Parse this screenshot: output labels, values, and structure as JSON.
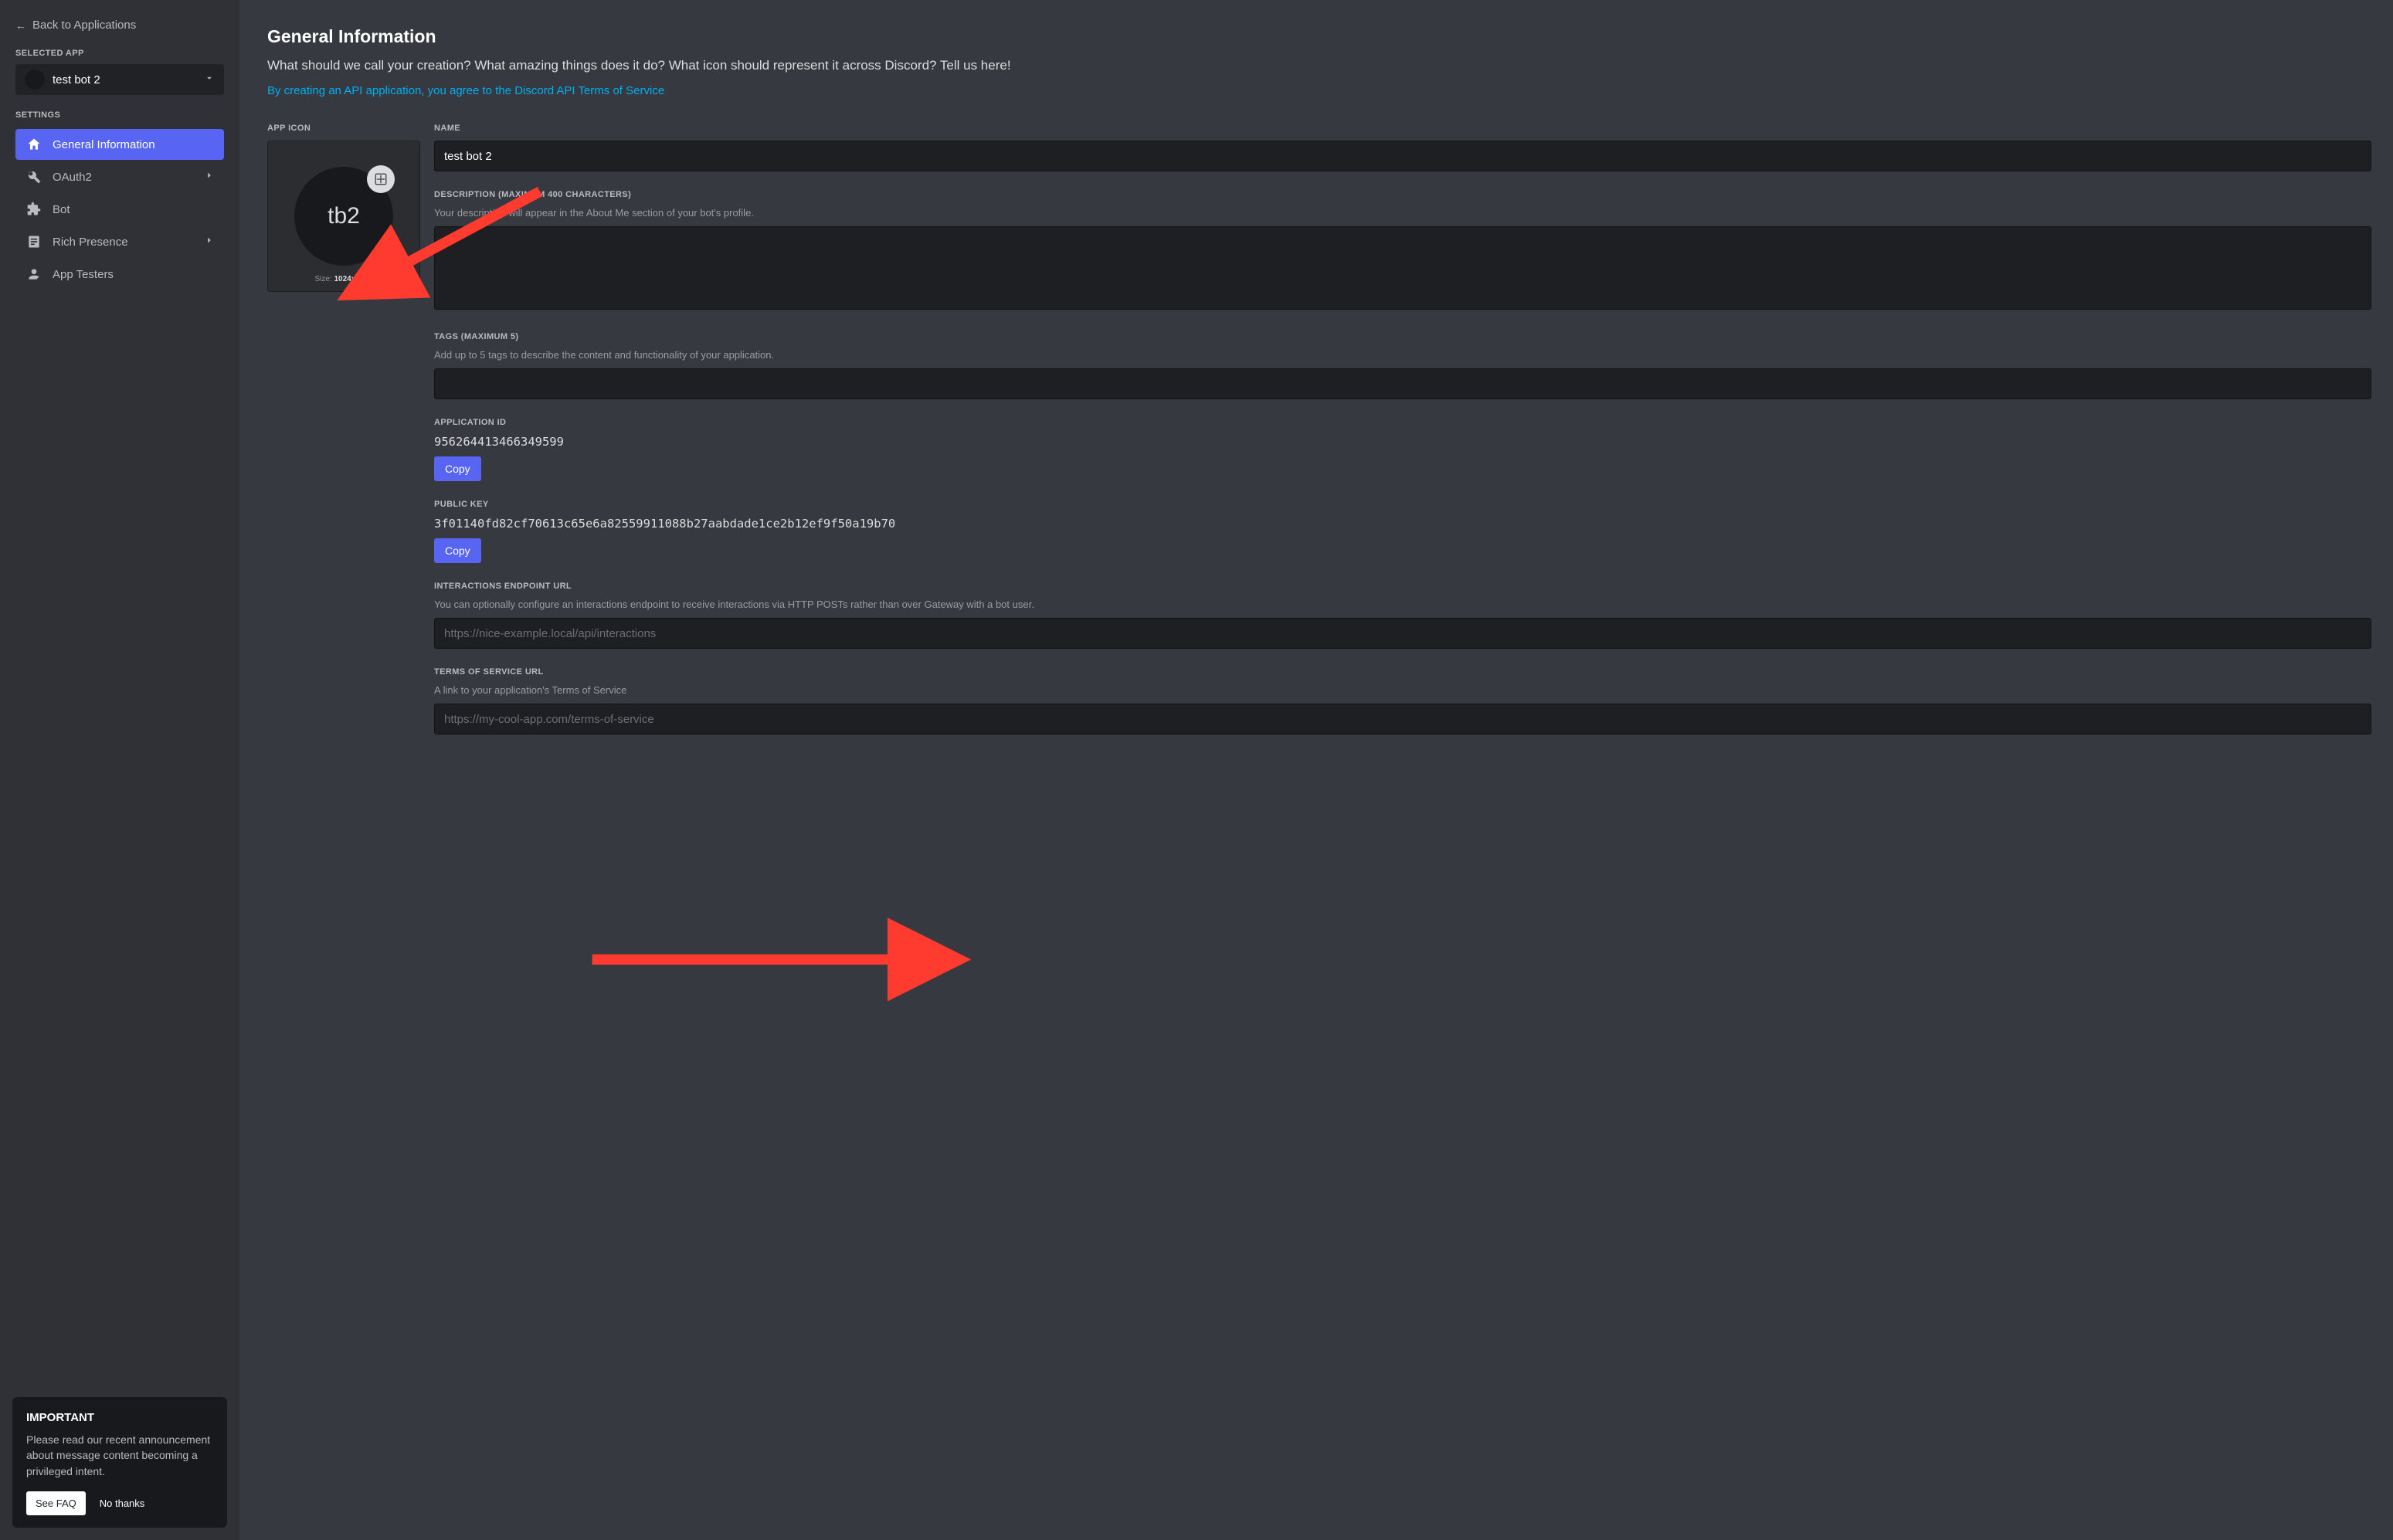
{
  "sidebar": {
    "back_label": "Back to Applications",
    "selected_app_heading": "SELECTED APP",
    "selected_app_name": "test bot 2",
    "settings_heading": "SETTINGS",
    "items": [
      {
        "label": "General Information"
      },
      {
        "label": "OAuth2"
      },
      {
        "label": "Bot"
      },
      {
        "label": "Rich Presence"
      },
      {
        "label": "App Testers"
      }
    ]
  },
  "important_box": {
    "title": "IMPORTANT",
    "body": "Please read our recent announcement about message content becoming a privileged intent.",
    "see_faq": "See FAQ",
    "no_thanks": "No thanks"
  },
  "page": {
    "title": "General Information",
    "subtitle": "What should we call your creation? What amazing things does it do? What icon should represent it across Discord? Tell us here!",
    "tos_link": "By creating an API application, you agree to the Discord API Terms of Service"
  },
  "app_icon": {
    "label": "APP ICON",
    "initials": "tb2",
    "size_prefix": "Size: ",
    "size_value": "1024x1024"
  },
  "name": {
    "label": "NAME",
    "value": "test bot 2"
  },
  "description": {
    "label": "DESCRIPTION (MAXIMUM 400 CHARACTERS)",
    "help": "Your description will appear in the About Me section of your bot's profile."
  },
  "tags": {
    "label": "TAGS (MAXIMUM 5)",
    "help": "Add up to 5 tags to describe the content and functionality of your application."
  },
  "application_id": {
    "label": "APPLICATION ID",
    "value": "956264413466349599",
    "copy": "Copy"
  },
  "public_key": {
    "label": "PUBLIC KEY",
    "value": "3f01140fd82cf70613c65e6a82559911088b27aabdade1ce2b12ef9f50a19b70",
    "copy": "Copy"
  },
  "interactions": {
    "label": "INTERACTIONS ENDPOINT URL",
    "help": "You can optionally configure an interactions endpoint to receive interactions via HTTP POSTs rather than over Gateway with a bot user.",
    "placeholder": "https://nice-example.local/api/interactions"
  },
  "tos_url": {
    "label": "TERMS OF SERVICE URL",
    "help": "A link to your application's Terms of Service",
    "placeholder": "https://my-cool-app.com/terms-of-service"
  }
}
